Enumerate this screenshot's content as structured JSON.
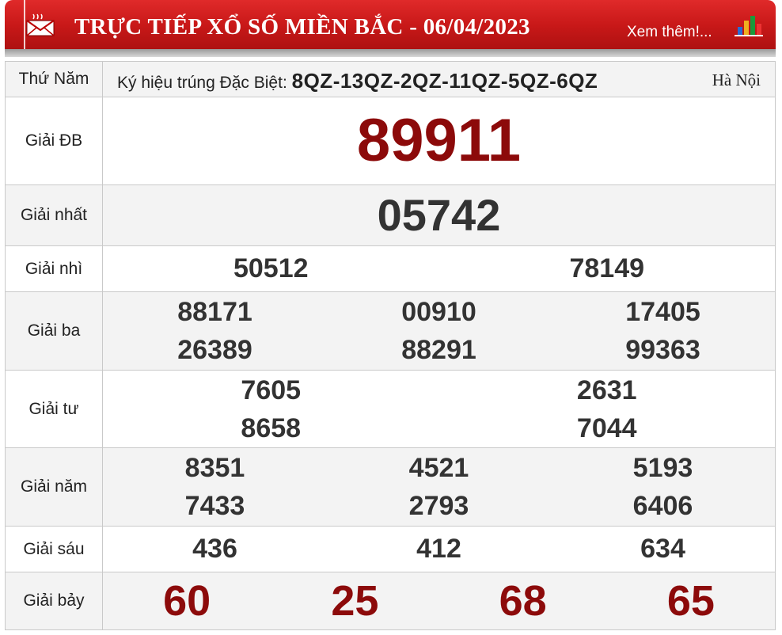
{
  "header": {
    "title": "TRỰC TIẾP XỔ SỐ MIỀN BẮC - 06/04/2023",
    "more_link": "Xem thêm!...",
    "icons": {
      "left": "mail-icon",
      "right": "bar-chart-icon"
    },
    "colors": {
      "banner": "#c81818",
      "prize_red": "#8c0a0a"
    }
  },
  "info": {
    "day": "Thứ Năm",
    "kyhieu_label": "Ký hiệu trúng Đặc Biệt:",
    "kyhieu_codes": "8QZ-13QZ-2QZ-11QZ-5QZ-6QZ",
    "province": "Hà Nội"
  },
  "prizes": {
    "db": {
      "label": "Giải ĐB",
      "numbers": [
        "89911"
      ]
    },
    "nhat": {
      "label": "Giải nhất",
      "numbers": [
        "05742"
      ]
    },
    "nhi": {
      "label": "Giải nhì",
      "numbers": [
        "50512",
        "78149"
      ]
    },
    "ba": {
      "label": "Giải ba",
      "numbers": [
        "88171",
        "00910",
        "17405",
        "26389",
        "88291",
        "99363"
      ]
    },
    "tu": {
      "label": "Giải tư",
      "numbers": [
        "7605",
        "2631",
        "8658",
        "7044"
      ]
    },
    "nam": {
      "label": "Giải năm",
      "numbers": [
        "8351",
        "4521",
        "5193",
        "7433",
        "2793",
        "6406"
      ]
    },
    "sau": {
      "label": "Giải sáu",
      "numbers": [
        "436",
        "412",
        "634"
      ]
    },
    "bay": {
      "label": "Giải bảy",
      "numbers": [
        "60",
        "25",
        "68",
        "65"
      ]
    }
  }
}
